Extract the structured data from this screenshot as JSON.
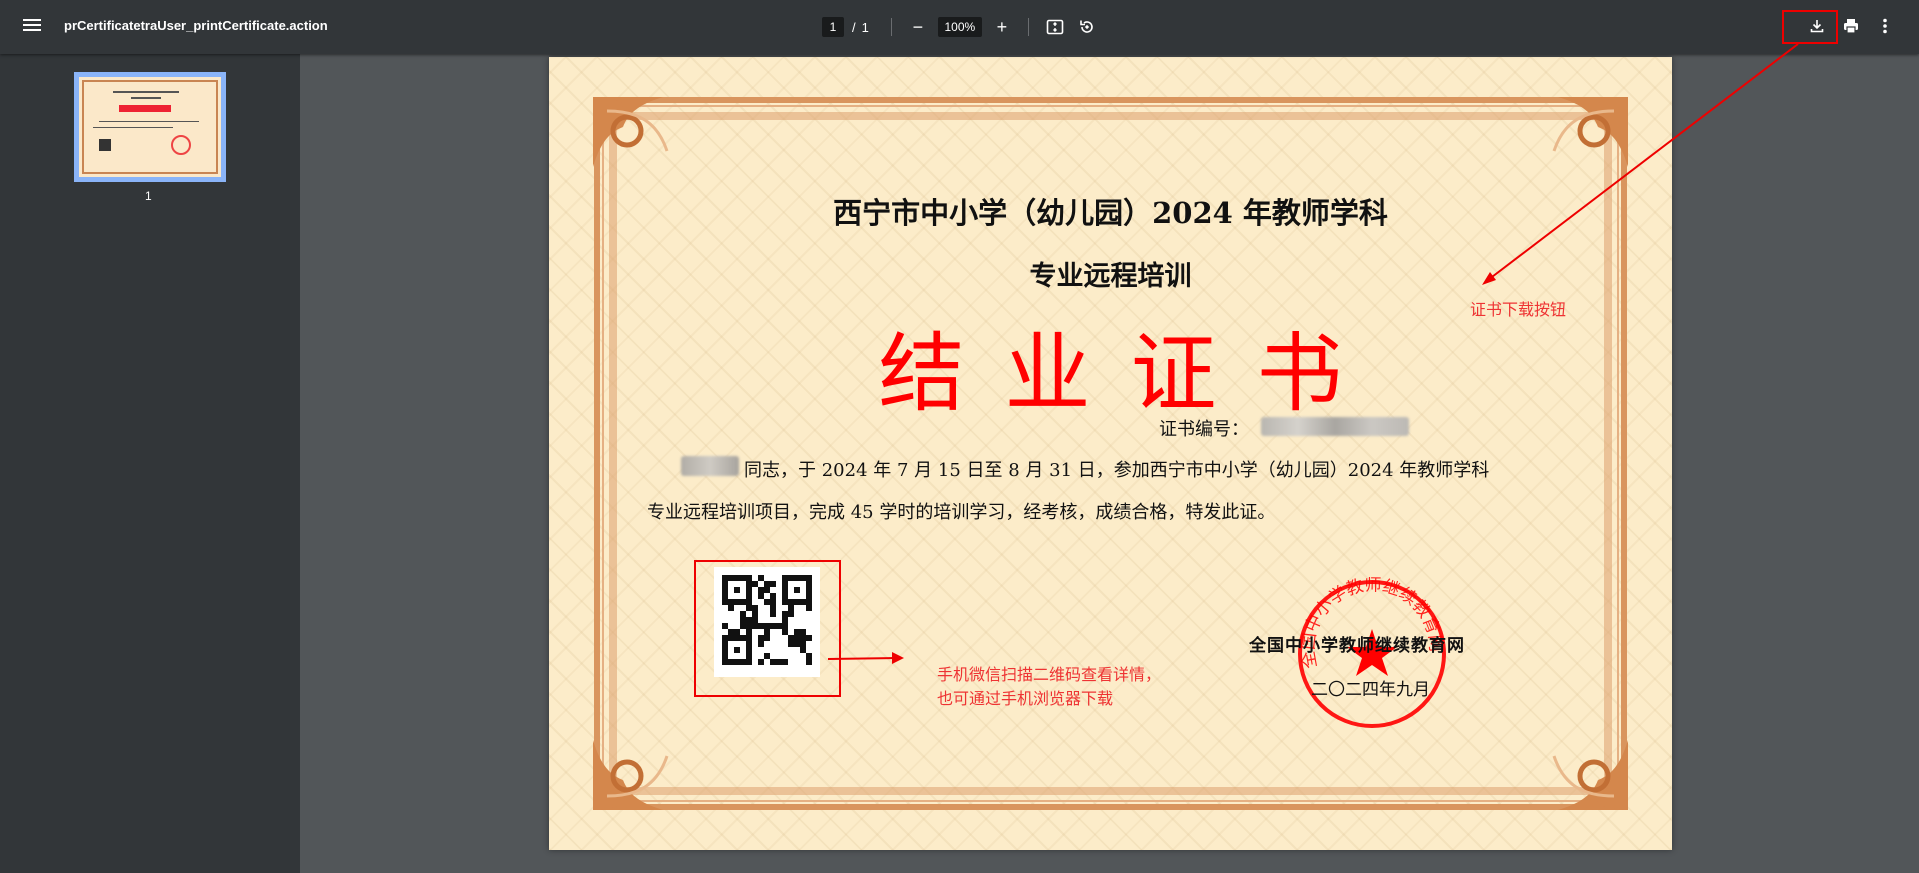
{
  "toolbar": {
    "file_name": "prCertificatetraUser_printCertificate.action",
    "page_current": "1",
    "page_separator": "/",
    "page_total": "1",
    "zoom": "100%",
    "zoom_out": "−",
    "zoom_in": "+"
  },
  "sidebar": {
    "thumbnails": [
      {
        "page_number": "1"
      }
    ]
  },
  "certificate": {
    "title_line1": "西宁市中小学（幼儿园）2024 年教师学科",
    "title_line2": "专业远程培训",
    "main_title": "结业证书",
    "cert_no_label": "证书编号：",
    "body_line1": "同志，于 2024 年 7 月 15 日至 8 月 31 日，参加西宁市中小学（幼儿园）2024 年教师学科",
    "body_line2": "专业远程培训项目，完成 45 学时的培训学习，经考核，成绩合格，特发此证。",
    "issuer": "全国中小学教师继续教育网",
    "issue_date": "二〇二四年九月",
    "seal_text": "全国中小学教师继续教育网"
  },
  "annotations": {
    "download_hint": "证书下载按钮",
    "qr_hint_line1": "手机微信扫描二维码查看详情，",
    "qr_hint_line2": "也可通过手机浏览器下载"
  },
  "colors": {
    "toolbar_bg": "#323639",
    "viewer_bg": "#525659",
    "annotation_red": "#ee3333",
    "certificate_red": "#ff0000"
  },
  "icons": [
    "menu-icon",
    "fit-page-icon",
    "rotate-icon",
    "download-icon",
    "print-icon",
    "more-vert-icon"
  ]
}
